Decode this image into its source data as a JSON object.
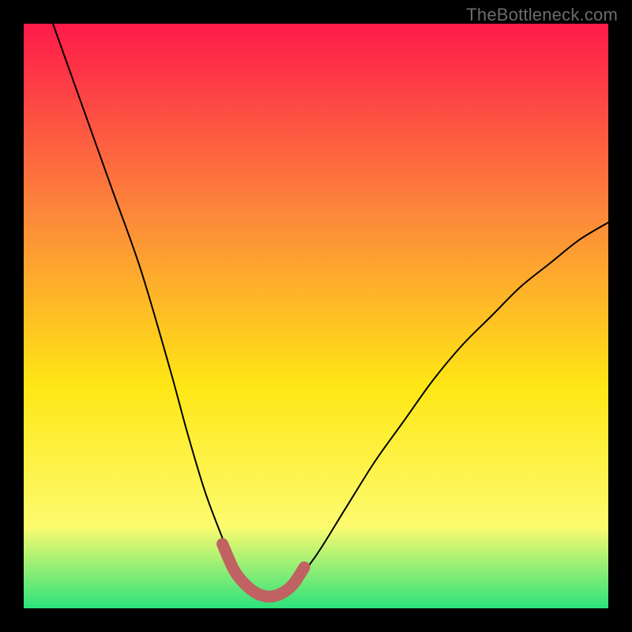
{
  "watermark": "TheBottleneck.com",
  "chart_data": {
    "type": "line",
    "title": "",
    "xlabel": "",
    "ylabel": "",
    "xlim": [
      0,
      100
    ],
    "ylim": [
      0,
      100
    ],
    "background_gradient": {
      "top": "#fd1a4a",
      "mid_upper": "#fd863b",
      "mid": "#fee715",
      "mid_lower": "#fdfb6f",
      "bottom": "#2ce27c"
    },
    "series": [
      {
        "name": "bottleneck-curve",
        "color": "#000000",
        "stroke_width": 2,
        "x": [
          5,
          10,
          15,
          20,
          25,
          28,
          31,
          34,
          36,
          38,
          40,
          42,
          44,
          46,
          50,
          55,
          60,
          65,
          70,
          75,
          80,
          85,
          90,
          95,
          100
        ],
        "values": [
          100,
          86,
          72,
          58,
          41,
          30,
          20,
          12,
          7,
          4,
          2.5,
          2,
          2.5,
          4,
          9,
          17,
          25,
          32,
          39,
          45,
          50,
          55,
          59,
          63,
          66
        ]
      },
      {
        "name": "optimal-zone-highlight",
        "color": "#c06262",
        "stroke_width": 15,
        "x": [
          34,
          36,
          38,
          40,
          42,
          44,
          46,
          48
        ],
        "values": [
          11,
          6.5,
          4,
          2.5,
          2,
          2.5,
          4,
          7
        ]
      }
    ]
  }
}
